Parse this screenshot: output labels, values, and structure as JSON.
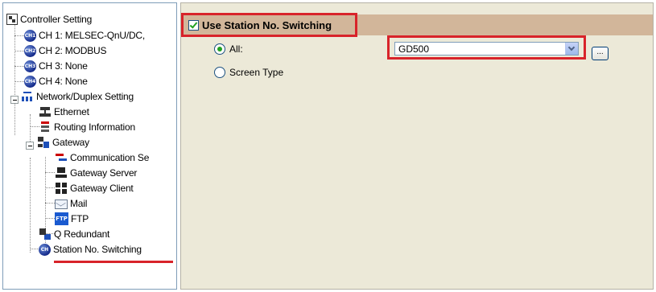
{
  "tree": {
    "items": [
      {
        "label": "Controller Setting",
        "icon": "controller-icon"
      },
      {
        "label": "CH 1: MELSEC-QnU/DC,",
        "icon": "ch1-icon",
        "badge": "CH1"
      },
      {
        "label": "CH 2: MODBUS",
        "icon": "ch2-icon",
        "badge": "CH2"
      },
      {
        "label": "CH 3: None",
        "icon": "ch3-icon",
        "badge": "CH3"
      },
      {
        "label": "CH 4: None",
        "icon": "ch4-icon",
        "badge": "CH4"
      },
      {
        "label": "Network/Duplex Setting",
        "icon": "network-icon"
      },
      {
        "label": "Ethernet",
        "icon": "ethernet-icon"
      },
      {
        "label": "Routing Information",
        "icon": "routing-icon"
      },
      {
        "label": "Gateway",
        "icon": "gateway-icon"
      },
      {
        "label": "Communication Se",
        "icon": "communication-icon"
      },
      {
        "label": "Gateway Server",
        "icon": "gateway-server-icon"
      },
      {
        "label": "Gateway Client",
        "icon": "gateway-client-icon"
      },
      {
        "label": "Mail",
        "icon": "mail-icon"
      },
      {
        "label": "FTP",
        "icon": "ftp-icon",
        "badge": "FTP"
      },
      {
        "label": "Q Redundant",
        "icon": "q-redundant-icon"
      },
      {
        "label": "Station No. Switching",
        "icon": "station-switching-icon",
        "badge": "CH"
      }
    ]
  },
  "panel": {
    "use_station_switching": {
      "label": "Use Station No. Switching",
      "checked": true
    },
    "radios": [
      {
        "label": "All:",
        "selected": true
      },
      {
        "label": "Screen Type",
        "selected": false
      }
    ],
    "combo": {
      "value": "GD500"
    },
    "browse_button": "..."
  },
  "colors": {
    "highlight_red": "#d8232a",
    "title_bar": "#d2b69a",
    "panel_bg": "#ece9d8"
  }
}
